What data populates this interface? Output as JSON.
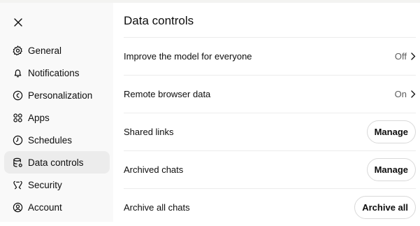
{
  "sidebar": {
    "close_icon": "close-icon",
    "items": [
      {
        "label": "General",
        "icon": "gear-icon"
      },
      {
        "label": "Notifications",
        "icon": "bell-icon"
      },
      {
        "label": "Personalization",
        "icon": "personalization-icon"
      },
      {
        "label": "Apps",
        "icon": "apps-grid-icon"
      },
      {
        "label": "Schedules",
        "icon": "clock-icon"
      },
      {
        "label": "Data controls",
        "icon": "database-gear-icon",
        "active": true
      },
      {
        "label": "Security",
        "icon": "shield-icon"
      },
      {
        "label": "Account",
        "icon": "user-circle-icon"
      }
    ]
  },
  "main": {
    "title": "Data controls",
    "rows": [
      {
        "label": "Improve the model for everyone",
        "value": "Off"
      },
      {
        "label": "Remote browser data",
        "value": "On"
      },
      {
        "label": "Shared links",
        "button": "Manage"
      },
      {
        "label": "Archived chats",
        "button": "Manage"
      },
      {
        "label": "Archive all chats",
        "button": "Archive all"
      }
    ]
  },
  "colors": {
    "sidebar_bg": "#f9f9f9",
    "active_bg": "#ececec",
    "divider": "#ececec",
    "text": "#0d0d0d",
    "muted": "#5d5d5d"
  }
}
